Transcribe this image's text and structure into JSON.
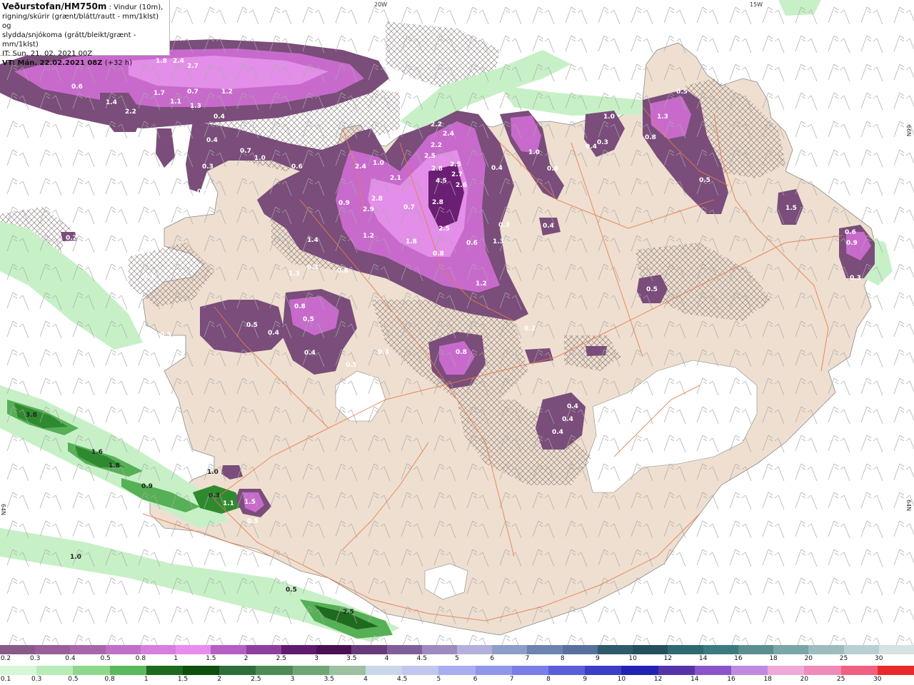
{
  "header": {
    "title": "Veðurstofan/HM750m",
    "desc_1": " : Vindur (10m),",
    "desc_2": "rigning/skúrir (grænt/blátt/rautt - mm/1klst) og",
    "desc_3": "slydda/snjókoma (grátt/bleikt/grænt - mm/1klst)",
    "it_line": "IT: Sun. 21. 02. 2021 00Z",
    "vt_bold": "VT: Mán. 22.02.2021 08Z",
    "vt_suffix": " (+32 h)"
  },
  "axis_labels": {
    "lon_20w": "20W",
    "lon_15w": "15W",
    "lat_66n": "66N",
    "lat_64n_left": "64N",
    "lat_64n_right": "64N"
  },
  "snow_values": [
    {
      "label": "1.8"
    },
    {
      "label": "2.4"
    },
    {
      "label": "2.7"
    },
    {
      "label": "0.6"
    },
    {
      "label": "1.4"
    },
    {
      "label": "2.2"
    },
    {
      "label": "1.7"
    },
    {
      "label": "1.1"
    },
    {
      "label": "0.7"
    },
    {
      "label": "1.3"
    },
    {
      "label": "1.2"
    },
    {
      "label": "0.4"
    },
    {
      "label": "0.4"
    },
    {
      "label": "0.3"
    },
    {
      "label": "0.5"
    },
    {
      "label": "0.7"
    },
    {
      "label": "1.0"
    },
    {
      "label": "0.6"
    },
    {
      "label": "2.2"
    },
    {
      "label": "2.4"
    },
    {
      "label": "2.2"
    },
    {
      "label": "2.5"
    },
    {
      "label": "2.8"
    },
    {
      "label": "2.7"
    },
    {
      "label": "4.5"
    },
    {
      "label": "2.6"
    },
    {
      "label": "2.5"
    },
    {
      "label": "2.8"
    },
    {
      "label": "2.9"
    },
    {
      "label": "2.4"
    },
    {
      "label": "1.0"
    },
    {
      "label": "2.1"
    },
    {
      "label": "0.9"
    },
    {
      "label": "0.7"
    },
    {
      "label": "2.8"
    },
    {
      "label": "2.5"
    },
    {
      "label": "1.2"
    },
    {
      "label": "1.8"
    },
    {
      "label": "0.8"
    },
    {
      "label": "0.6"
    },
    {
      "label": "1.3"
    },
    {
      "label": "1.2"
    },
    {
      "label": "0.4"
    },
    {
      "label": "1.0"
    },
    {
      "label": "0.8"
    },
    {
      "label": "1.0"
    },
    {
      "label": "0.4"
    },
    {
      "label": "0.3"
    },
    {
      "label": "0.5"
    },
    {
      "label": "1.3"
    },
    {
      "label": "0.8"
    },
    {
      "label": "0.5"
    },
    {
      "label": "1.5"
    },
    {
      "label": "0.6"
    },
    {
      "label": "0.9"
    },
    {
      "label": "0.3"
    },
    {
      "label": "0.3"
    },
    {
      "label": "0.4"
    },
    {
      "label": "0.5"
    },
    {
      "label": "0.8"
    },
    {
      "label": "0.5"
    },
    {
      "label": "0.5"
    },
    {
      "label": "0.4"
    },
    {
      "label": "0.3"
    },
    {
      "label": "0.4"
    },
    {
      "label": "0.5"
    },
    {
      "label": "0.4"
    },
    {
      "label": "0.3"
    },
    {
      "label": "0.8"
    },
    {
      "label": "0.4"
    },
    {
      "label": "0.4"
    },
    {
      "label": "0.4"
    },
    {
      "label": "0.2"
    },
    {
      "label": "1.4"
    },
    {
      "label": "0.3"
    },
    {
      "label": "0.6"
    },
    {
      "label": "1.3"
    },
    {
      "label": "0.3"
    },
    {
      "label": "0.2"
    },
    {
      "label": "1.5"
    },
    {
      "label": "1.1"
    },
    {
      "label": "0.5"
    }
  ],
  "rain_values": [
    {
      "label": "3.8"
    },
    {
      "label": "1.6"
    },
    {
      "label": "1.8"
    },
    {
      "label": "0.9"
    },
    {
      "label": "1.0"
    },
    {
      "label": "1.0"
    },
    {
      "label": "0.5"
    },
    {
      "label": "2.5"
    },
    {
      "label": "0.3"
    }
  ],
  "legend": {
    "snow_scale": [
      "0.2",
      "0.3",
      "0.4",
      "0.5",
      "0.8",
      "1",
      "1.5",
      "2",
      "2.5",
      "3",
      "3.5",
      "4",
      "4.5",
      "5",
      "6",
      "7",
      "8",
      "9",
      "10",
      "12",
      "14",
      "16",
      "18",
      "20",
      "25",
      "30"
    ],
    "snow_colors": [
      "#8a5a88",
      "#9a5f9a",
      "#a866aa",
      "#c070c6",
      "#d87ede",
      "#e98cef",
      "#b45fc4",
      "#8e3f9e",
      "#601a6e",
      "#4a1054",
      "#673b7a",
      "#7f5f9a",
      "#9c8ac0",
      "#b4b0dc",
      "#8e9ec8",
      "#6e84b0",
      "#58709c",
      "#2e5a6c",
      "#24505e",
      "#2e6a70",
      "#3c7a7e",
      "#5a8e90",
      "#7aa6a8",
      "#9cbcbe",
      "#b8d0d2",
      "#d6e2e4"
    ],
    "rain_scale": [
      "0.1",
      "0.3",
      "0.5",
      "0.8",
      "1",
      "1.5",
      "2",
      "2.5",
      "3",
      "3.5",
      "4",
      "4.5",
      "5",
      "6",
      "7",
      "8",
      "9",
      "10",
      "12",
      "14",
      "16",
      "18",
      "20",
      "25",
      "30"
    ],
    "rain_colors": [
      "#d8f6d8",
      "#b8ecb8",
      "#8ed88e",
      "#5cb85c",
      "#1e6a1e",
      "#0e4e0e",
      "#2e6e3a",
      "#4e8a56",
      "#6ea676",
      "#9cc0a0",
      "#c8d8e8",
      "#c0c6f0",
      "#a8aef0",
      "#9096ea",
      "#7a7ee6",
      "#5a5ed8",
      "#3c3ec8",
      "#2222b4",
      "#5533a8",
      "#8a55c8",
      "#c08ae0",
      "#f0a8d8",
      "#f08ab8",
      "#f06080",
      "#e82a2a"
    ]
  }
}
